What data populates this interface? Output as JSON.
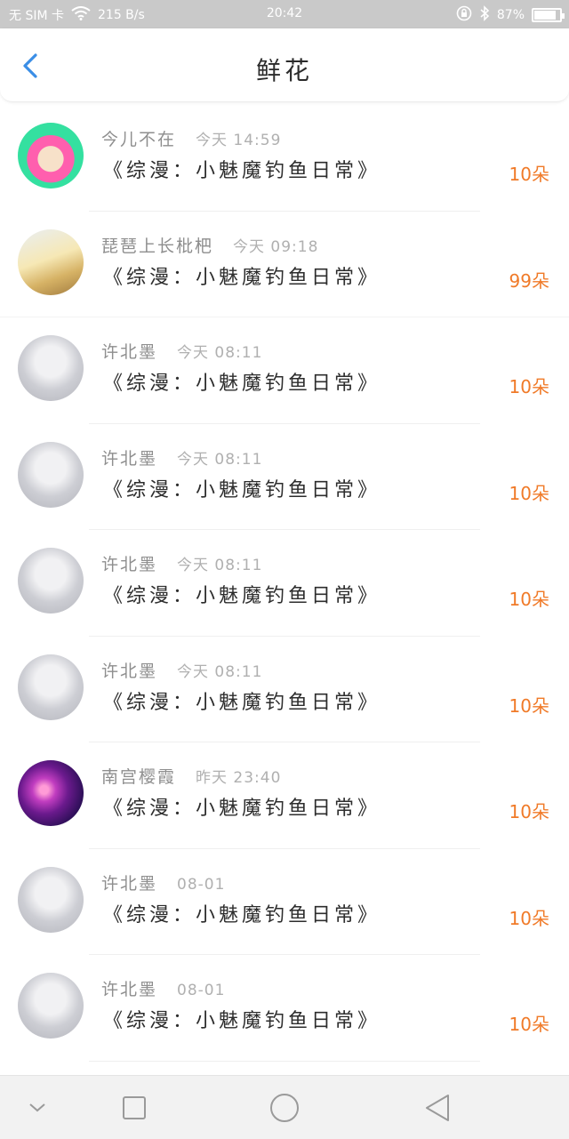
{
  "status_bar": {
    "carrier": "无 SIM 卡",
    "speed": "215 B/s",
    "time": "20:42",
    "battery": "87%",
    "battery_level": 0.87
  },
  "header": {
    "title": "鲜花"
  },
  "colors": {
    "accent": "#3a8ee6",
    "amount": "#f07a28"
  },
  "items": [
    {
      "name": "今儿不在",
      "time": "今天 14:59",
      "book": "《综漫：小魅魔钓鱼日常》",
      "amount": "10朵",
      "avatar": "pink-hair-avatar"
    },
    {
      "name": "琵琶上长枇杷",
      "time": "今天 09:18",
      "book": "《综漫：小魅魔钓鱼日常》",
      "amount": "99朵",
      "avatar": "scenery-avatar"
    },
    {
      "name": "许北墨",
      "time": "今天 08:11",
      "book": "《综漫：小魅魔钓鱼日常》",
      "amount": "10朵",
      "avatar": "white-hair-avatar"
    },
    {
      "name": "许北墨",
      "time": "今天 08:11",
      "book": "《综漫：小魅魔钓鱼日常》",
      "amount": "10朵",
      "avatar": "white-hair-avatar"
    },
    {
      "name": "许北墨",
      "time": "今天 08:11",
      "book": "《综漫：小魅魔钓鱼日常》",
      "amount": "10朵",
      "avatar": "white-hair-avatar"
    },
    {
      "name": "许北墨",
      "time": "今天 08:11",
      "book": "《综漫：小魅魔钓鱼日常》",
      "amount": "10朵",
      "avatar": "white-hair-avatar"
    },
    {
      "name": "南宫樱霞",
      "time": "昨天 23:40",
      "book": "《综漫：小魅魔钓鱼日常》",
      "amount": "10朵",
      "avatar": "galaxy-avatar"
    },
    {
      "name": "许北墨",
      "time": "08-01",
      "book": "《综漫：小魅魔钓鱼日常》",
      "amount": "10朵",
      "avatar": "white-hair-avatar"
    },
    {
      "name": "许北墨",
      "time": "08-01",
      "book": "《综漫：小魅魔钓鱼日常》",
      "amount": "10朵",
      "avatar": "white-hair-avatar"
    }
  ],
  "nav_bar": {
    "buttons": [
      "chevron-down-icon",
      "square-icon",
      "circle-icon",
      "triangle-back-icon"
    ]
  }
}
